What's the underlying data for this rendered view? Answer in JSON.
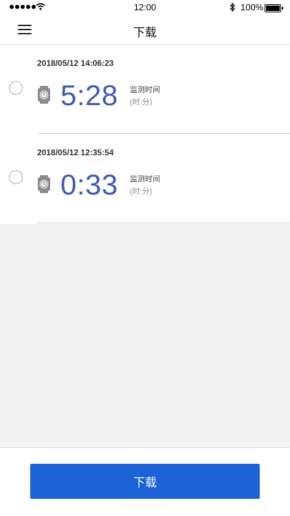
{
  "status_bar": {
    "time": "12:00",
    "battery": "100%"
  },
  "header": {
    "title": "下载",
    "menu_icon": "hamburger-menu-icon"
  },
  "records": [
    {
      "date": "2018/05/12 14:06:23",
      "duration": "5:28",
      "label": "监测时间",
      "unit": "(时:分)",
      "icon": "watch-icon"
    },
    {
      "date": "2018/05/12 12:35:54",
      "duration": "0:33",
      "label": "监测时间",
      "unit": "(时:分)",
      "icon": "watch-icon"
    }
  ],
  "footer": {
    "download_label": "下载"
  },
  "colors": {
    "accent": "#3c5bb7",
    "button": "#1a62d6"
  }
}
